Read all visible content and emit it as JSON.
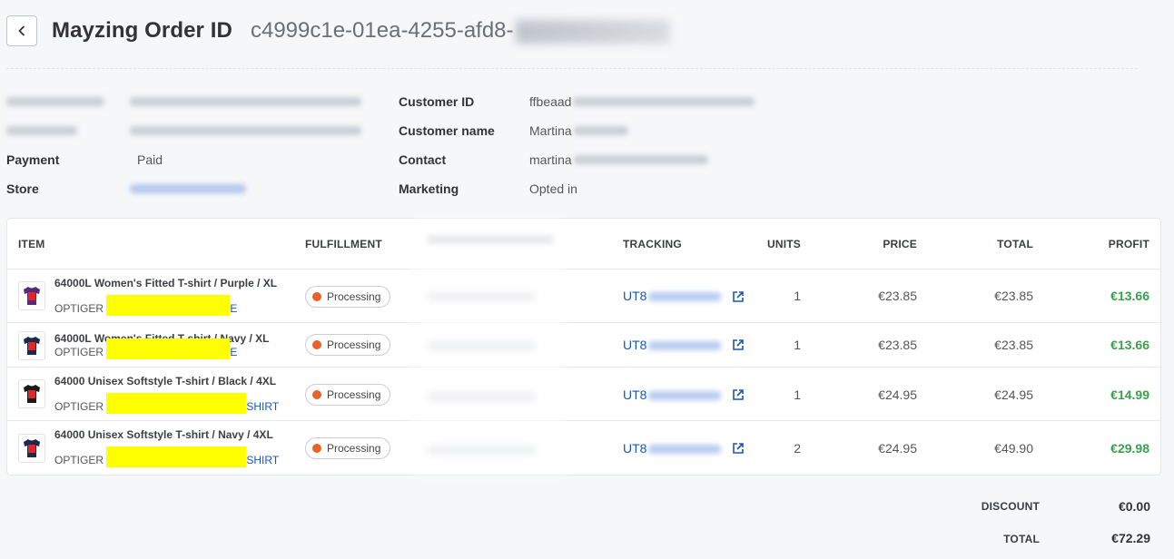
{
  "header": {
    "title": "Mayzing Order ID",
    "order_id": "c4999c1e-01ea-4255-afd8-"
  },
  "info_left": [
    {
      "label": "",
      "value": ""
    },
    {
      "label": "",
      "value": ""
    },
    {
      "label": "Payment",
      "value": "Paid"
    },
    {
      "label": "Store",
      "value": ""
    }
  ],
  "info_right": [
    {
      "label": "Customer ID",
      "value": "ffbeaad"
    },
    {
      "label": "Customer name",
      "value": "Martina"
    },
    {
      "label": "Contact",
      "value": "martina"
    },
    {
      "label": "Marketing",
      "value": "Opted in"
    }
  ],
  "table": {
    "headers": {
      "item": "ITEM",
      "fulfillment": "FULFILLMENT",
      "tracking": "TRACKING",
      "units": "UNITS",
      "price": "PRICE",
      "total": "TOTAL",
      "profit": "PROFIT"
    },
    "rows": [
      {
        "name": "64000L Women's Fitted T-shirt / Purple / XL",
        "sku_prefix": "OPTIGER",
        "sku_tail": "E",
        "status": "Processing",
        "tracking": "UT8",
        "units": "1",
        "price": "€23.85",
        "total": "€23.85",
        "profit": "€13.66",
        "shirt_color": "#5a2a7a"
      },
      {
        "name": "64000L Women's Fitted T-shirt / Navy / XL",
        "sku_prefix": "OPTIGER",
        "sku_tail": "E",
        "status": "Processing",
        "tracking": "UT8",
        "units": "1",
        "price": "€23.85",
        "total": "€23.85",
        "profit": "€13.66",
        "shirt_color": "#1d2a4a"
      },
      {
        "name": "64000 Unisex Softstyle T-shirt / Black / 4XL",
        "sku_prefix": "OPTIGER",
        "sku_tail": "SHIRT",
        "status": "Processing",
        "tracking": "UT8",
        "units": "1",
        "price": "€24.95",
        "total": "€24.95",
        "profit": "€14.99",
        "shirt_color": "#1a1a1a"
      },
      {
        "name": "64000 Unisex Softstyle T-shirt / Navy / 4XL",
        "sku_prefix": "OPTIGER",
        "sku_tail": "SHIRT",
        "status": "Processing",
        "tracking": "UT8",
        "units": "2",
        "price": "€24.95",
        "total": "€49.90",
        "profit": "€29.98",
        "shirt_color": "#1d2a4a"
      }
    ]
  },
  "summary": {
    "discount_label": "DISCOUNT",
    "discount_value": "€0.00",
    "total_label": "TOTAL",
    "total_value": "€72.29"
  },
  "icons": {
    "back": "chevron-left-icon",
    "external": "external-link-icon",
    "status": "status-dot-icon",
    "shirt": "tshirt-icon"
  },
  "colors": {
    "link": "#1a56b8",
    "profit": "#38a14a",
    "status_dot": "#e8622a",
    "highlight": "#ffff00"
  }
}
